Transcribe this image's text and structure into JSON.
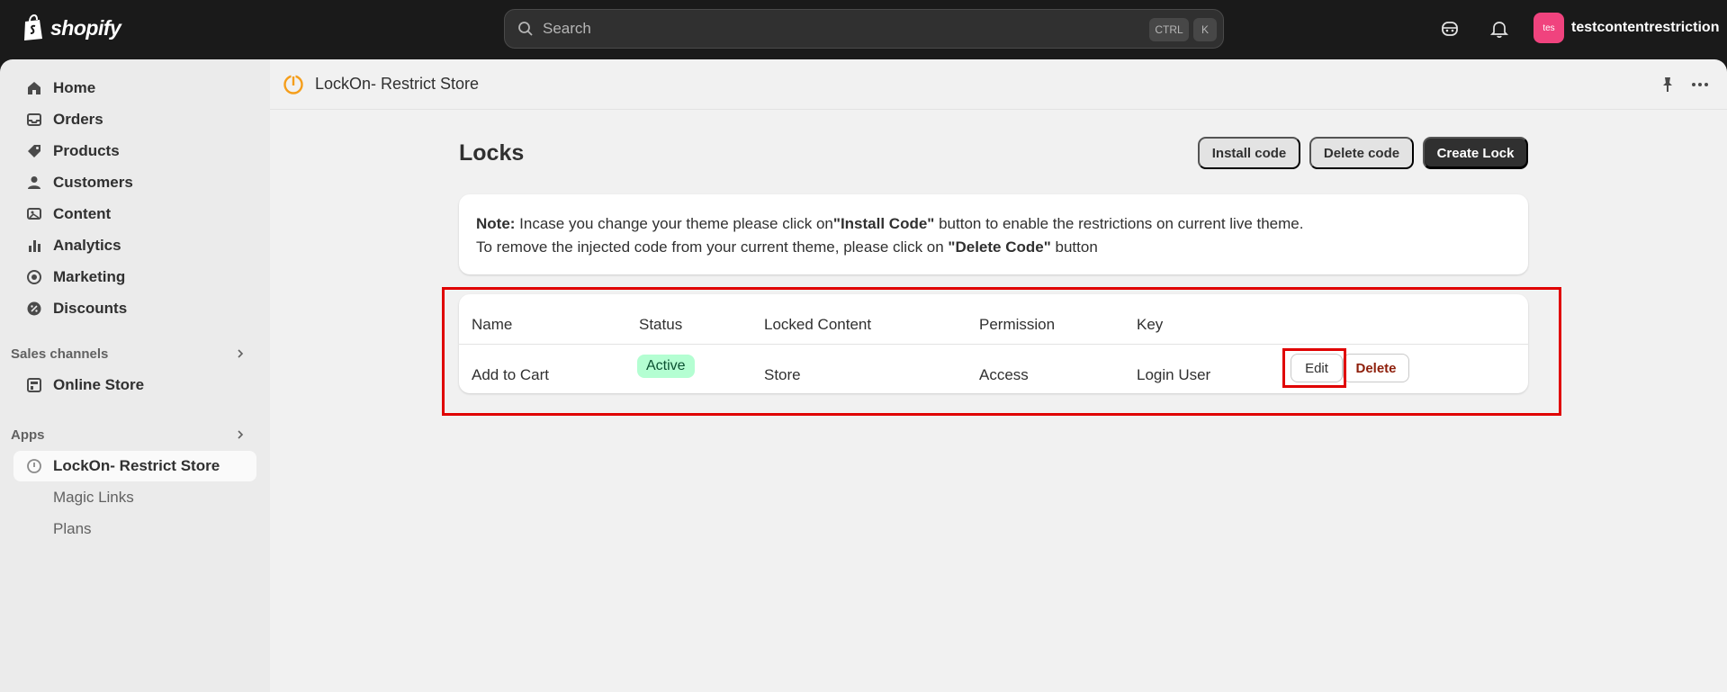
{
  "topbar": {
    "brand": "shopify",
    "search_placeholder": "Search",
    "shortcut_ctrl": "CTRL",
    "shortcut_k": "K",
    "avatar_initials": "tes",
    "store_name": "testcontentrestriction"
  },
  "sidebar": {
    "items": [
      {
        "label": "Home",
        "icon": "home-icon"
      },
      {
        "label": "Orders",
        "icon": "inbox-icon"
      },
      {
        "label": "Products",
        "icon": "tag-icon"
      },
      {
        "label": "Customers",
        "icon": "person-icon"
      },
      {
        "label": "Content",
        "icon": "image-icon"
      },
      {
        "label": "Analytics",
        "icon": "bar-chart-icon"
      },
      {
        "label": "Marketing",
        "icon": "target-icon"
      },
      {
        "label": "Discounts",
        "icon": "discount-icon"
      }
    ],
    "sales_channels_label": "Sales channels",
    "online_store": "Online Store",
    "apps_label": "Apps",
    "app_name": "LockOn- Restrict Store",
    "app_subitems": [
      "Magic Links",
      "Plans"
    ]
  },
  "appbar": {
    "title": "LockOn- Restrict Store"
  },
  "page": {
    "title": "Locks",
    "install_code": "Install code",
    "delete_code": "Delete code",
    "create_lock": "Create Lock"
  },
  "note": {
    "label": "Note:",
    "line1_a": " Incase you change your theme please click on",
    "line1_b": "\"Install Code\"",
    "line1_c": " button to enable the restrictions on current live theme.",
    "line2_a": "To remove the injected code from your current theme, please click on ",
    "line2_b": "\"Delete Code\"",
    "line2_c": " button"
  },
  "table": {
    "headers": [
      "Name",
      "Status",
      "Locked Content",
      "Permission",
      "Key"
    ],
    "rows": [
      {
        "name": "Add to Cart",
        "status": "Active",
        "content": "Store",
        "permission": "Access",
        "key": "Login User",
        "edit": "Edit",
        "delete": "Delete"
      }
    ]
  },
  "colors": {
    "topbar": "#1a1a1a",
    "highlight": "#e00000",
    "status_active_bg": "#b4fed2",
    "delete_text": "#8e1f0b"
  }
}
